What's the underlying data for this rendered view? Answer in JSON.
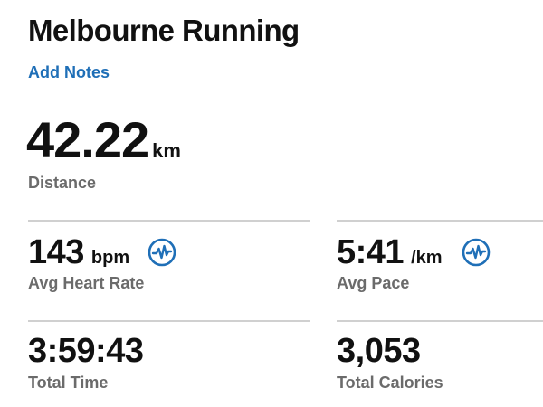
{
  "activity": {
    "title": "Melbourne Running",
    "add_notes_label": "Add Notes"
  },
  "distance": {
    "value": "42.22",
    "unit": "km",
    "label": "Distance"
  },
  "heart_rate": {
    "value": "143",
    "unit": "bpm",
    "label": "Avg Heart Rate",
    "icon": "heart-rate-chart-icon"
  },
  "pace": {
    "value": "5:41",
    "unit": "/km",
    "label": "Avg Pace",
    "icon": "pace-chart-icon"
  },
  "total_time": {
    "value": "3:59:43",
    "label": "Total Time"
  },
  "calories": {
    "value": "3,053",
    "label": "Total Calories"
  },
  "colors": {
    "link": "#1f6fb7",
    "icon": "#1f6fb7",
    "primary_text": "#111111",
    "label_text": "#6b6b6b",
    "divider": "#d0d0d0"
  }
}
